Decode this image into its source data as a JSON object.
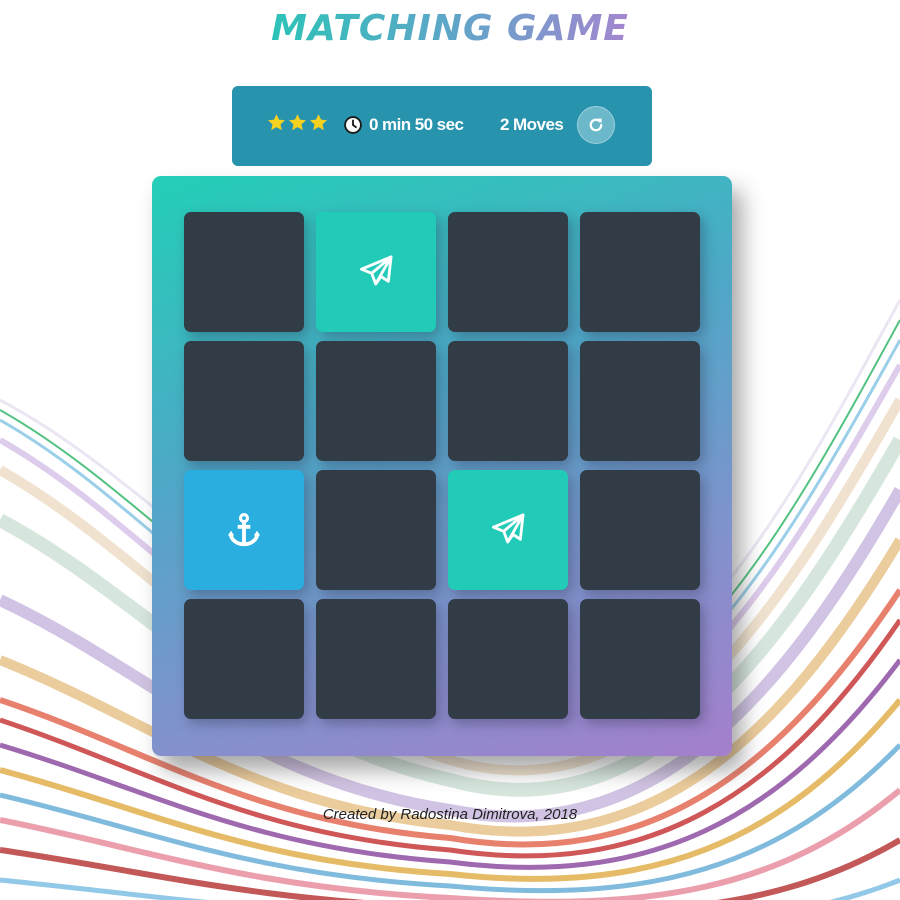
{
  "title": "MATCHING GAME",
  "score_panel": {
    "stars_count": 3,
    "timer_minutes": "0",
    "timer_min_label": "min",
    "timer_seconds": "50",
    "timer_sec_label": "sec",
    "moves_count": "2",
    "moves_label": "Moves",
    "restart_icon": "refresh-icon"
  },
  "deck": {
    "rows": 4,
    "cols": 4,
    "cards": [
      {
        "state": "closed"
      },
      {
        "state": "open",
        "icon": "paper-plane-icon"
      },
      {
        "state": "closed"
      },
      {
        "state": "closed"
      },
      {
        "state": "closed"
      },
      {
        "state": "closed"
      },
      {
        "state": "closed"
      },
      {
        "state": "closed"
      },
      {
        "state": "show",
        "icon": "anchor-icon"
      },
      {
        "state": "closed"
      },
      {
        "state": "open",
        "icon": "paper-plane-icon"
      },
      {
        "state": "closed"
      },
      {
        "state": "closed"
      },
      {
        "state": "closed"
      },
      {
        "state": "closed"
      },
      {
        "state": "closed"
      }
    ]
  },
  "footer": "Created by Radostina Dimitrova, 2018",
  "colors": {
    "card_closed": "#323c47",
    "card_open": "#22cbb8",
    "card_show": "#2aaee0",
    "panel": "#2893ad",
    "star": "#f5d120"
  }
}
